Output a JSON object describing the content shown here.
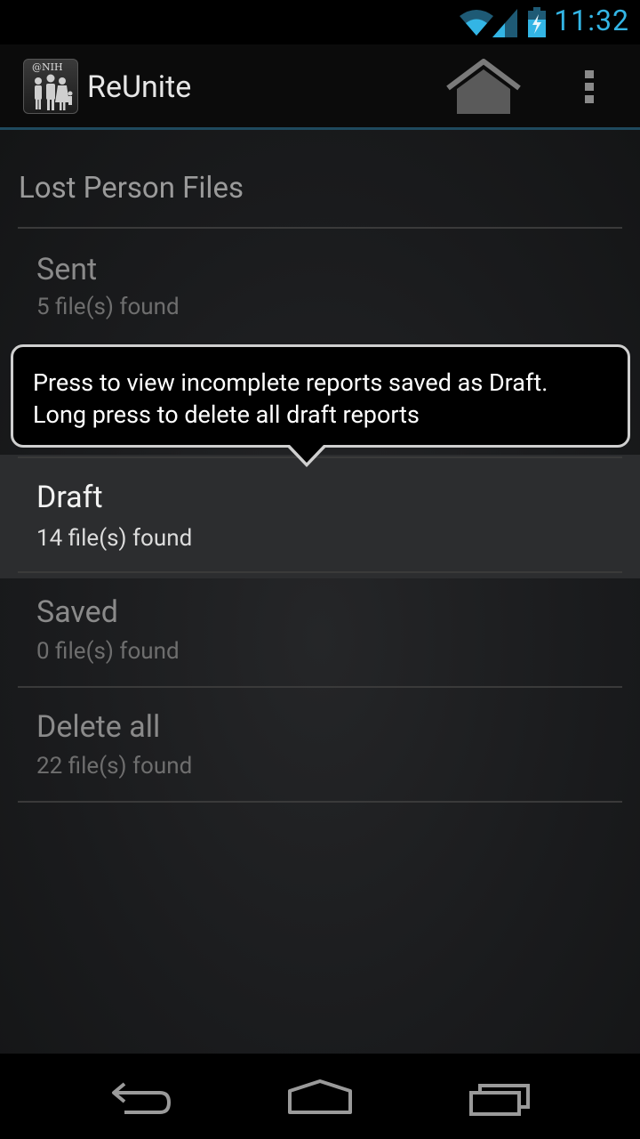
{
  "status_bar": {
    "time": "11:32"
  },
  "action_bar": {
    "app_icon_label": "@NIH",
    "title": "ReUnite"
  },
  "section": {
    "title": "Lost Person Files"
  },
  "rows": [
    {
      "title": "Sent",
      "subtitle": "5 file(s) found"
    },
    {
      "title": "Draft",
      "subtitle": "14 file(s) found"
    },
    {
      "title": "Saved",
      "subtitle": "0 file(s) found"
    },
    {
      "title": "Delete all",
      "subtitle": "22 file(s) found"
    }
  ],
  "tooltip": {
    "line1": "Press to view incomplete reports saved as Draft.",
    "line2": "Long press to delete all draft reports"
  },
  "colors": {
    "accent": "#33b5e5",
    "highlight": "#2c2d2f"
  },
  "icons": [
    "wifi-icon",
    "signal-icon",
    "battery-charging-icon",
    "home-icon",
    "overflow-menu-icon",
    "back-icon",
    "home-nav-icon",
    "recents-icon"
  ]
}
